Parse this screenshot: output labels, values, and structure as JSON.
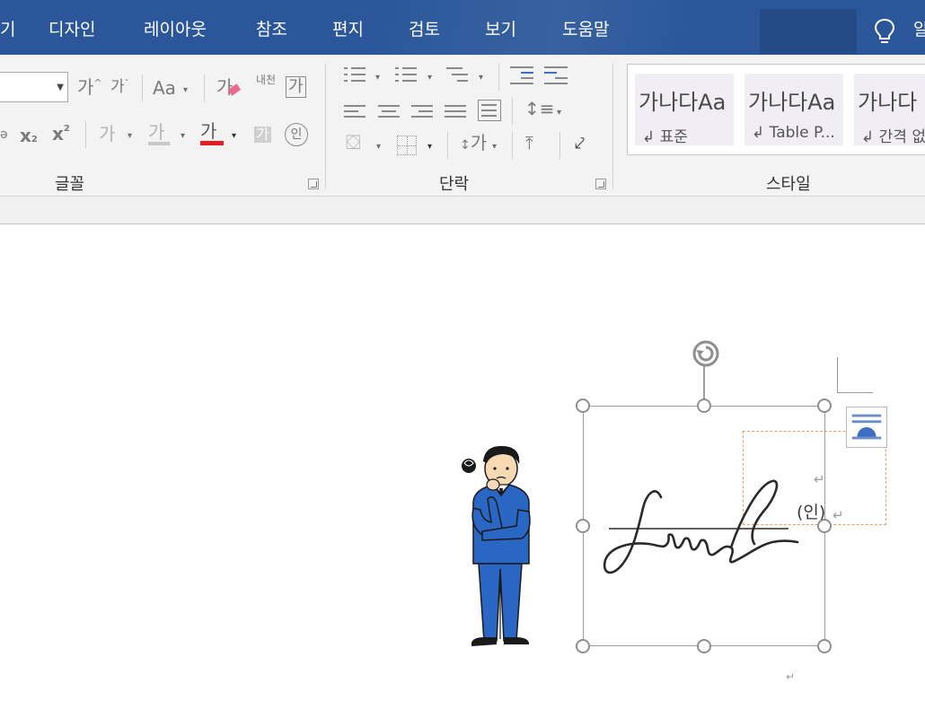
{
  "menu": {
    "tabs": [
      {
        "label": "기"
      },
      {
        "label": "디자인"
      },
      {
        "label": "레이아웃"
      },
      {
        "label": "참조"
      },
      {
        "label": "편지"
      },
      {
        "label": "검토"
      },
      {
        "label": "보기"
      },
      {
        "label": "도움말"
      }
    ],
    "cut_right": "알"
  },
  "ribbon": {
    "font_group": {
      "label": "글꼴",
      "grow": "가",
      "shrink": "가",
      "change_case": "Aa",
      "clear_format": "가",
      "phonetic": "내천",
      "char_border": "가",
      "subscript": "x",
      "superscript": "x",
      "text_effect": "가",
      "highlight": "가",
      "font_color": "가",
      "char_shading": "가",
      "enclose": "인"
    },
    "paragraph_group": {
      "label": "단락",
      "sort": "가"
    },
    "styles_group": {
      "label": "스타일",
      "styles": [
        {
          "preview": "가나다Aa",
          "name": "↲ 표준"
        },
        {
          "preview": "가나다Aa",
          "name": "↲ Table P..."
        },
        {
          "preview": "가나다",
          "name": "↲ 간격 없"
        }
      ]
    }
  },
  "document": {
    "seal_text": "(인)",
    "para_mark": "↵"
  },
  "colors": {
    "tab_bar": "#2b579a",
    "font_color_bar": "#e51c23",
    "eraser": "#e96a8f",
    "selection_dash": "#f0a060",
    "suit_blue": "#2a66c4"
  }
}
